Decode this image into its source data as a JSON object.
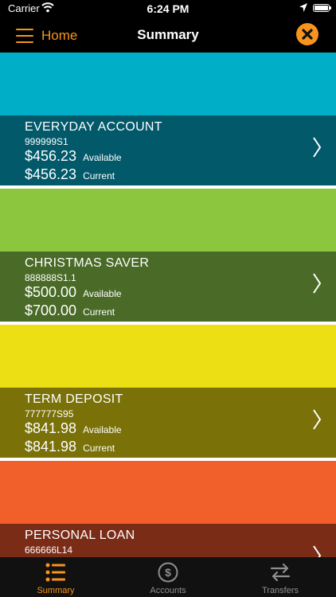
{
  "status_bar": {
    "carrier": "Carrier",
    "time": "6:24 PM"
  },
  "nav": {
    "menu_label": "Home",
    "title": "Summary"
  },
  "accounts": [
    {
      "name": "EVERYDAY ACCOUNT",
      "number": "999999S1",
      "available": "$456.23",
      "available_label": "Available",
      "current": "$456.23",
      "current_label": "Current",
      "band_color": "#00aec7",
      "info_color": "#01596a"
    },
    {
      "name": "CHRISTMAS SAVER",
      "number": "888888S1.1",
      "available": "$500.00",
      "available_label": "Available",
      "current": "$700.00",
      "current_label": "Current",
      "band_color": "#8cc63f",
      "info_color": "#4a6b27"
    },
    {
      "name": "TERM DEPOSIT",
      "number": "777777S95",
      "available": "$841.98",
      "available_label": "Available",
      "current": "$841.98",
      "current_label": "Current",
      "band_color": "#ecdf14",
      "info_color": "#7a7108"
    },
    {
      "name": "PERSONAL LOAN",
      "number": "666666L14",
      "band_color": "#f15f2a",
      "info_color": "#7a2c17"
    }
  ],
  "tabs": [
    {
      "label": "Summary",
      "icon": "list-icon",
      "active": true
    },
    {
      "label": "Accounts",
      "icon": "dollar-circle-icon",
      "active": false
    },
    {
      "label": "Transfers",
      "icon": "transfer-arrows-icon",
      "active": false
    }
  ],
  "colors": {
    "accent": "#f7941d",
    "tab_bar": "#111111",
    "inactive_tab": "#8e8e8e"
  }
}
